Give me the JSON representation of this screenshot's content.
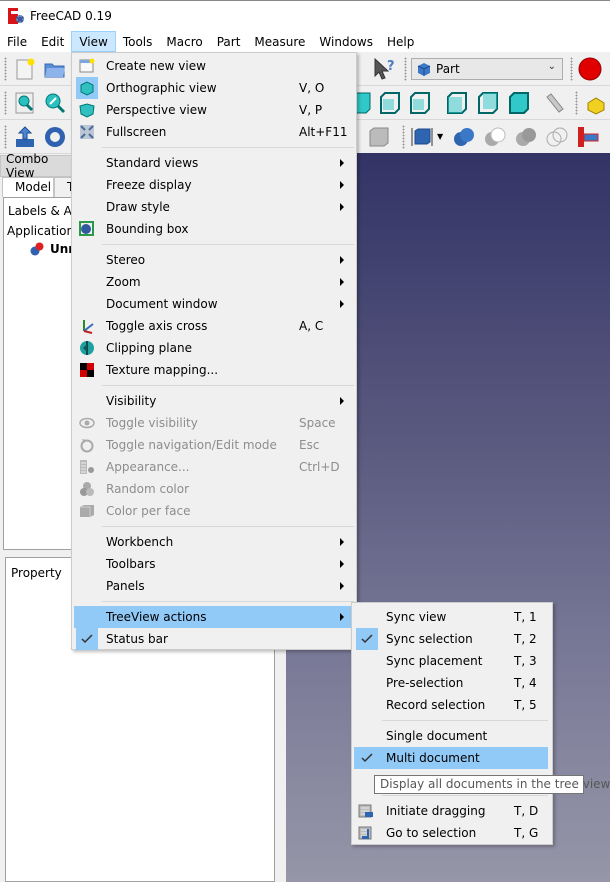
{
  "window": {
    "title": "FreeCAD 0.19"
  },
  "menubar": {
    "items": [
      "File",
      "Edit",
      "View",
      "Tools",
      "Macro",
      "Part",
      "Measure",
      "Windows",
      "Help"
    ],
    "active": "View"
  },
  "toolbar": {
    "workbench_selector": {
      "value": "Part"
    }
  },
  "combo_view": {
    "title": "Combo View",
    "tabs": [
      "Model",
      "T"
    ],
    "tree": {
      "header": "Labels & Att",
      "root": "Application",
      "document": "Unn"
    },
    "property_header": "Property"
  },
  "view_menu": {
    "items": [
      {
        "label": "Create new view",
        "icon": "new-view-icon"
      },
      {
        "label": "Orthographic view",
        "shortcut": "V, O",
        "icon": "orthographic-cube-icon",
        "checked": true
      },
      {
        "label": "Perspective view",
        "shortcut": "V, P",
        "icon": "perspective-cube-icon"
      },
      {
        "label": "Fullscreen",
        "shortcut": "Alt+F11",
        "icon": "fullscreen-icon"
      },
      {
        "label": "Standard views",
        "submenu": true
      },
      {
        "label": "Freeze display",
        "submenu": true
      },
      {
        "label": "Draw style",
        "submenu": true
      },
      {
        "label": "Bounding box",
        "icon": "bounding-box-icon"
      },
      {
        "label": "Stereo",
        "submenu": true
      },
      {
        "label": "Zoom",
        "submenu": true
      },
      {
        "label": "Document window",
        "submenu": true
      },
      {
        "label": "Toggle axis cross",
        "shortcut": "A, C",
        "icon": "axis-cross-icon"
      },
      {
        "label": "Clipping plane",
        "icon": "clipping-plane-icon"
      },
      {
        "label": "Texture mapping...",
        "icon": "texture-mapping-icon"
      },
      {
        "label": "Visibility",
        "submenu": true
      },
      {
        "label": "Toggle visibility",
        "shortcut": "Space",
        "icon": "eye-icon",
        "disabled": true
      },
      {
        "label": "Toggle navigation/Edit mode",
        "shortcut": "Esc",
        "icon": "navigation-mode-icon",
        "disabled": true
      },
      {
        "label": "Appearance...",
        "shortcut": "Ctrl+D",
        "icon": "appearance-icon",
        "disabled": true
      },
      {
        "label": "Random color",
        "icon": "random-color-icon",
        "disabled": true
      },
      {
        "label": "Color per face",
        "icon": "color-per-face-icon",
        "disabled": true
      },
      {
        "label": "Workbench",
        "submenu": true
      },
      {
        "label": "Toolbars",
        "submenu": true
      },
      {
        "label": "Panels",
        "submenu": true
      },
      {
        "label": "TreeView actions",
        "submenu": true,
        "highlighted": true
      },
      {
        "label": "Status bar",
        "checked": true
      }
    ]
  },
  "treeview_submenu": {
    "items": [
      {
        "label": "Sync view",
        "shortcut": "T, 1"
      },
      {
        "label": "Sync selection",
        "shortcut": "T, 2",
        "checked": true
      },
      {
        "label": "Sync placement",
        "shortcut": "T, 3"
      },
      {
        "label": "Pre-selection",
        "shortcut": "T, 4"
      },
      {
        "label": "Record selection",
        "shortcut": "T, 5"
      },
      {
        "label": "Single document"
      },
      {
        "label": "Multi document",
        "checked": true,
        "highlighted": true
      },
      {
        "label": "Initiate dragging",
        "shortcut": "T, D",
        "icon": "initiate-dragging-icon"
      },
      {
        "label": "Go to selection",
        "shortcut": "T, G",
        "icon": "go-to-selection-icon"
      }
    ]
  },
  "tooltip": {
    "text": "Display all documents in the tree view"
  },
  "colors": {
    "menu_bg": "#f0f0f0",
    "highlight": "#91c9f7",
    "menubar_active": "#cce8ff",
    "disabled_text": "#8d8d8d",
    "viewport_top": "#333366",
    "viewport_bottom": "#9696a8"
  }
}
